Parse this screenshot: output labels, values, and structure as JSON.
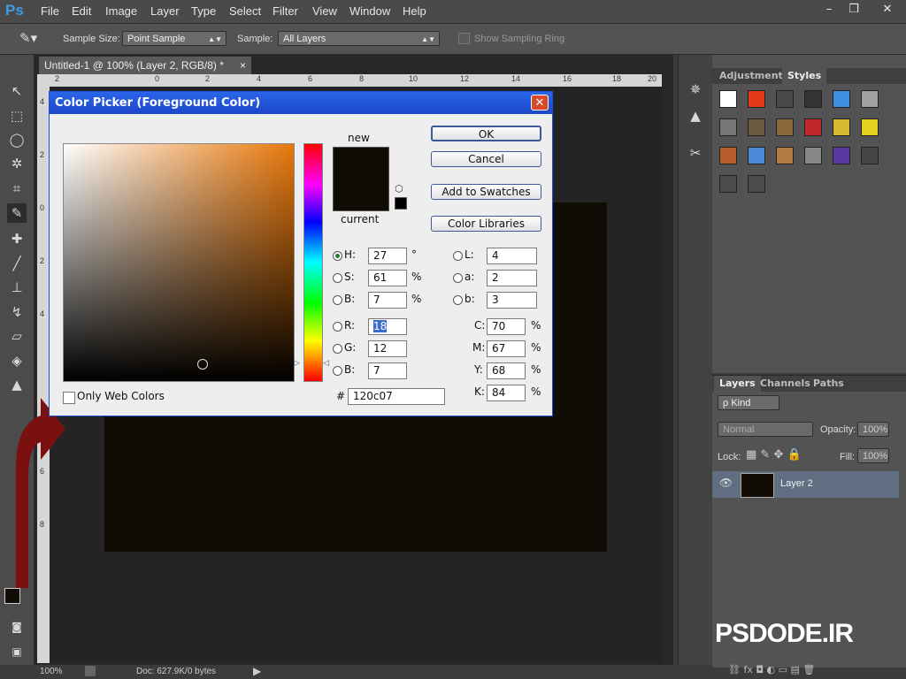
{
  "app": {
    "logo": "Ps"
  },
  "menu": [
    "File",
    "Edit",
    "Image",
    "Layer",
    "Type",
    "Select",
    "Filter",
    "View",
    "Window",
    "Help"
  ],
  "window_buttons": [
    "–",
    "❐",
    "✕"
  ],
  "options": {
    "sample_size_label": "Sample Size:",
    "sample_size_value": "Point Sample",
    "sample_label": "Sample:",
    "sample_value": "All Layers",
    "show_ring": "Show Sampling Ring"
  },
  "document": {
    "tab_title": "Untitled-1 @ 100% (Layer 2, RGB/8) *",
    "tab_close": "×",
    "ruler_top": [
      "2",
      "0",
      "2",
      "4",
      "6",
      "8",
      "10",
      "12",
      "14",
      "16",
      "18",
      "20"
    ],
    "ruler_left": [
      "4",
      "2",
      "0",
      "2",
      "4",
      "6",
      "8"
    ],
    "canvas_color": "#120c07"
  },
  "status": {
    "zoom": "100%",
    "doc": "Doc: 627.9K/0 bytes"
  },
  "styles_panel": {
    "tabs": [
      "Adjustments",
      "Styles"
    ],
    "swatch_colors": [
      [
        "#ffffff",
        "#e23b1a",
        "#4a4a4a",
        "#333333",
        "#3c8ede",
        "#a0a0a0"
      ],
      [
        "#777777",
        "#6b5a3d",
        "#8a6a3a",
        "#c0282b",
        "#d8b830",
        "#e4d020"
      ],
      [
        "#b85a2a",
        "#4a8ad8",
        "#b07a40",
        "#888888",
        "#5a3aa0",
        "#444444"
      ],
      [
        "#4b4b4b",
        "#4b4b4b"
      ]
    ]
  },
  "layers_panel": {
    "tabs": [
      "Layers",
      "Channels",
      "Paths"
    ],
    "kind": "ρ Kind",
    "blend_mode": "Normal",
    "opacity_label": "Opacity:",
    "opacity_value": "100%",
    "lock_label": "Lock:",
    "fill_label": "Fill:",
    "fill_value": "100%",
    "layer_name": "Layer 2",
    "eye": "👁",
    "footer": "⛓  fx  ◘  ◐  ▭  ▤  🗑"
  },
  "dialog": {
    "title": "Color Picker (Foreground Color)",
    "close": "✕",
    "new_label": "new",
    "current_label": "current",
    "new_color": "#120c07",
    "current_color": "#120c07",
    "buttons": {
      "ok": "OK",
      "cancel": "Cancel",
      "add_swatches": "Add to Swatches",
      "libraries": "Color Libraries"
    },
    "hsb": [
      {
        "label": "H:",
        "value": "27",
        "unit": "°"
      },
      {
        "label": "S:",
        "value": "61",
        "unit": "%"
      },
      {
        "label": "B:",
        "value": "7",
        "unit": "%"
      }
    ],
    "rgb": [
      {
        "label": "R:",
        "value": "18"
      },
      {
        "label": "G:",
        "value": "12"
      },
      {
        "label": "B:",
        "value": "7"
      }
    ],
    "lab": [
      {
        "label": "L:",
        "value": "4"
      },
      {
        "label": "a:",
        "value": "2"
      },
      {
        "label": "b:",
        "value": "3"
      }
    ],
    "cmyk": [
      {
        "label": "C:",
        "value": "70",
        "unit": "%"
      },
      {
        "label": "M:",
        "value": "67",
        "unit": "%"
      },
      {
        "label": "Y:",
        "value": "68",
        "unit": "%"
      },
      {
        "label": "K:",
        "value": "84",
        "unit": "%"
      }
    ],
    "hex_label": "#",
    "hex_value": "120c07",
    "web_only": "Only Web Colors"
  },
  "watermark": "PSDODE.IR",
  "accent_color": "#8b1a1a"
}
